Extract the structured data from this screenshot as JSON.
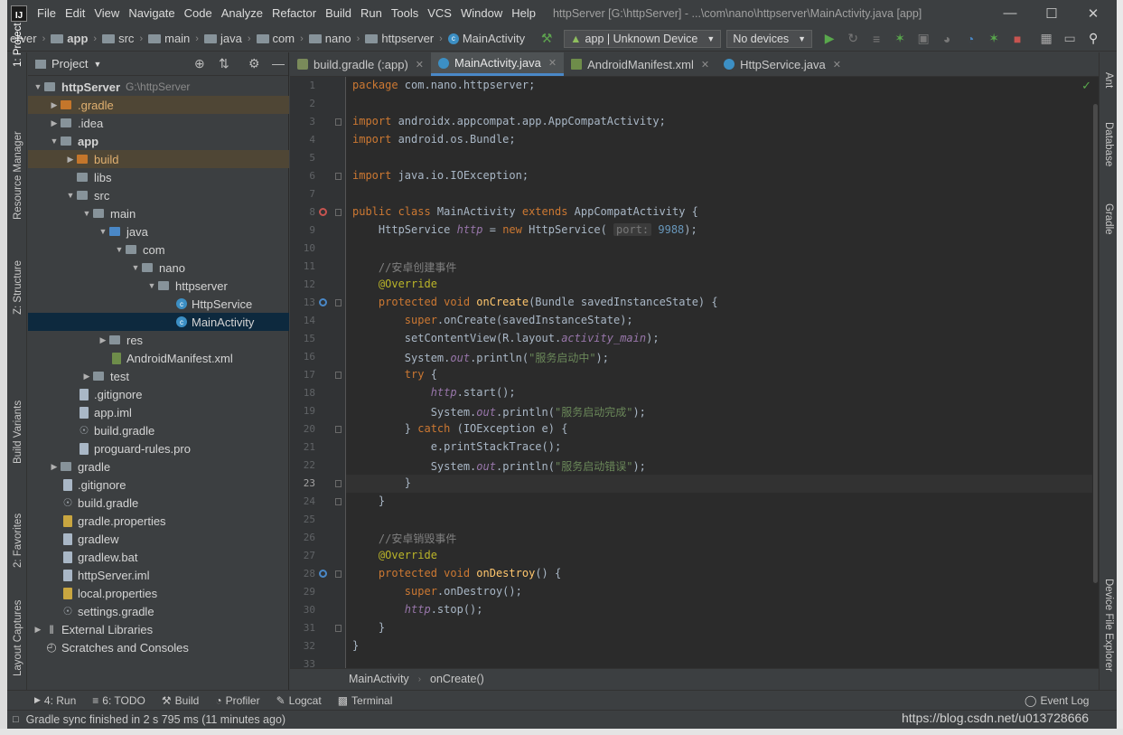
{
  "app": {
    "logo": "IJ",
    "title": "httpServer [G:\\httpServer] - ...\\com\\nano\\httpserver\\MainActivity.java [app]"
  },
  "menu": [
    "File",
    "Edit",
    "View",
    "Navigate",
    "Code",
    "Analyze",
    "Refactor",
    "Build",
    "Run",
    "Tools",
    "VCS",
    "Window",
    "Help"
  ],
  "nav": {
    "crumbs": [
      "erver",
      "app",
      "src",
      "main",
      "java",
      "com",
      "nano",
      "httpserver",
      "MainActivity"
    ],
    "run_config": "app | Unknown Device",
    "device": "No devices"
  },
  "left_tool_tabs": [
    "1: Project",
    "Resource Manager",
    "Z: Structure",
    "Build Variants",
    "2: Favorites",
    "Layout Captures"
  ],
  "right_tool_tabs": [
    "Ant",
    "Database",
    "Gradle",
    "Device File Explorer"
  ],
  "project": {
    "header": "Project",
    "root_path": "G:\\httpServer",
    "tree": [
      {
        "label": "httpServer",
        "depth": 0,
        "arrow": "open",
        "icon": "folder",
        "bold": true
      },
      {
        "label": ".gradle",
        "depth": 1,
        "arrow": "closed",
        "icon": "folder-orange",
        "hl": "orange"
      },
      {
        "label": ".idea",
        "depth": 1,
        "arrow": "closed",
        "icon": "folder"
      },
      {
        "label": "app",
        "depth": 1,
        "arrow": "open",
        "icon": "folder",
        "bold": true
      },
      {
        "label": "build",
        "depth": 2,
        "arrow": "closed",
        "icon": "folder-orange",
        "hl": "orange"
      },
      {
        "label": "libs",
        "depth": 2,
        "arrow": "",
        "icon": "folder"
      },
      {
        "label": "src",
        "depth": 2,
        "arrow": "open",
        "icon": "folder"
      },
      {
        "label": "main",
        "depth": 3,
        "arrow": "open",
        "icon": "folder"
      },
      {
        "label": "java",
        "depth": 4,
        "arrow": "open",
        "icon": "folder-blue"
      },
      {
        "label": "com",
        "depth": 5,
        "arrow": "open",
        "icon": "folder"
      },
      {
        "label": "nano",
        "depth": 6,
        "arrow": "open",
        "icon": "folder"
      },
      {
        "label": "httpserver",
        "depth": 7,
        "arrow": "open",
        "icon": "folder"
      },
      {
        "label": "HttpService",
        "depth": 8,
        "arrow": "",
        "icon": "class"
      },
      {
        "label": "MainActivity",
        "depth": 8,
        "arrow": "",
        "icon": "class",
        "hl": "selected"
      },
      {
        "label": "res",
        "depth": 4,
        "arrow": "closed",
        "icon": "folder"
      },
      {
        "label": "AndroidManifest.xml",
        "depth": 4,
        "arrow": "",
        "icon": "manifest"
      },
      {
        "label": "test",
        "depth": 3,
        "arrow": "closed",
        "icon": "folder"
      },
      {
        "label": ".gitignore",
        "depth": 2,
        "arrow": "",
        "icon": "file"
      },
      {
        "label": "app.iml",
        "depth": 2,
        "arrow": "",
        "icon": "file"
      },
      {
        "label": "build.gradle",
        "depth": 2,
        "arrow": "",
        "icon": "gradle"
      },
      {
        "label": "proguard-rules.pro",
        "depth": 2,
        "arrow": "",
        "icon": "file"
      },
      {
        "label": "gradle",
        "depth": 1,
        "arrow": "closed",
        "icon": "folder"
      },
      {
        "label": ".gitignore",
        "depth": 1,
        "arrow": "",
        "icon": "file"
      },
      {
        "label": "build.gradle",
        "depth": 1,
        "arrow": "",
        "icon": "gradle"
      },
      {
        "label": "gradle.properties",
        "depth": 1,
        "arrow": "",
        "icon": "props"
      },
      {
        "label": "gradlew",
        "depth": 1,
        "arrow": "",
        "icon": "file"
      },
      {
        "label": "gradlew.bat",
        "depth": 1,
        "arrow": "",
        "icon": "file"
      },
      {
        "label": "httpServer.iml",
        "depth": 1,
        "arrow": "",
        "icon": "file"
      },
      {
        "label": "local.properties",
        "depth": 1,
        "arrow": "",
        "icon": "props"
      },
      {
        "label": "settings.gradle",
        "depth": 1,
        "arrow": "",
        "icon": "gradle"
      },
      {
        "label": "External Libraries",
        "depth": 0,
        "arrow": "closed",
        "icon": "lib"
      },
      {
        "label": "Scratches and Consoles",
        "depth": 0,
        "arrow": "",
        "icon": "scratch"
      }
    ]
  },
  "tabs": [
    {
      "label": "build.gradle (:app)",
      "icon": "g"
    },
    {
      "label": "MainActivity.java",
      "icon": "c",
      "active": true
    },
    {
      "label": "AndroidManifest.xml",
      "icon": "m"
    },
    {
      "label": "HttpService.java",
      "icon": "c"
    }
  ],
  "code_lines": [
    [
      [
        "k",
        "package "
      ],
      [
        "",
        "com.nano.httpserver;"
      ]
    ],
    [],
    [
      [
        "k",
        "import "
      ],
      [
        "",
        "androidx.appcompat.app.AppCompatActivity;"
      ]
    ],
    [
      [
        "k",
        "import "
      ],
      [
        "",
        "android.os.Bundle;"
      ]
    ],
    [],
    [
      [
        "k",
        "import "
      ],
      [
        "",
        "java.io.IOException;"
      ]
    ],
    [],
    [
      [
        "k",
        "public class "
      ],
      [
        "",
        "MainActivity "
      ],
      [
        "k",
        "extends "
      ],
      [
        "",
        "AppCompatActivity {"
      ]
    ],
    [
      [
        "",
        "    HttpService "
      ],
      [
        "f",
        "http"
      ],
      [
        "",
        ""
      ],
      [
        "",
        " = "
      ],
      [
        "k",
        "new "
      ],
      [
        "",
        "HttpService( "
      ],
      [
        "h",
        "port:"
      ],
      [
        "n",
        " 9988"
      ],
      [
        "",
        ");"
      ]
    ],
    [],
    [
      [
        "c",
        "    //安卓创建事件"
      ]
    ],
    [
      [
        "a",
        "    @Override"
      ]
    ],
    [
      [
        "k",
        "    protected void "
      ],
      [
        "m",
        "onCreate"
      ],
      [
        "",
        "(Bundle savedInstanceState) {"
      ]
    ],
    [
      [
        "k",
        "        super"
      ],
      [
        "",
        ".onCreate(savedInstanceState);"
      ]
    ],
    [
      [
        "",
        "        setContentView(R.layout."
      ],
      [
        "f",
        "activity_main"
      ],
      [
        "",
        ");"
      ]
    ],
    [
      [
        "",
        "        System."
      ],
      [
        "f",
        "out"
      ],
      [
        "",
        ".println("
      ],
      [
        "s",
        "\"服务启动中\""
      ],
      [
        "",
        ");"
      ]
    ],
    [
      [
        "k",
        "        try "
      ],
      [
        "",
        "{"
      ]
    ],
    [
      [
        "f",
        "            http"
      ],
      [
        "",
        ".start();"
      ]
    ],
    [
      [
        "",
        "            System."
      ],
      [
        "f",
        "out"
      ],
      [
        "",
        ".println("
      ],
      [
        "s",
        "\"服务启动完成\""
      ],
      [
        "",
        ");"
      ]
    ],
    [
      [
        "",
        "        } "
      ],
      [
        "k",
        "catch "
      ],
      [
        "",
        "(IOException e) {"
      ]
    ],
    [
      [
        "",
        "            e.printStackTrace();"
      ]
    ],
    [
      [
        "",
        "            System."
      ],
      [
        "f",
        "out"
      ],
      [
        "",
        ".println("
      ],
      [
        "s",
        "\"服务启动错误\""
      ],
      [
        "",
        ");"
      ]
    ],
    [
      [
        "",
        "        }"
      ]
    ],
    [
      [
        "",
        "    }"
      ]
    ],
    [],
    [
      [
        "c",
        "    //安卓销毁事件"
      ]
    ],
    [
      [
        "a",
        "    @Override"
      ]
    ],
    [
      [
        "k",
        "    protected void "
      ],
      [
        "m",
        "onDestroy"
      ],
      [
        "",
        "() {"
      ]
    ],
    [
      [
        "k",
        "        super"
      ],
      [
        "",
        ".onDestroy();"
      ]
    ],
    [
      [
        "f",
        "        http"
      ],
      [
        "",
        ".stop();"
      ]
    ],
    [
      [
        "",
        "    }"
      ]
    ],
    [
      [
        "",
        "}"
      ]
    ],
    []
  ],
  "editor_crumbs": [
    "MainActivity",
    "onCreate()"
  ],
  "bottom_tabs": [
    "4: Run",
    "6: TODO",
    "Build",
    "Profiler",
    "Logcat",
    "Terminal"
  ],
  "event_log": "Event Log",
  "status": "Gradle sync finished in 2 s 795 ms (11 minutes ago)",
  "watermark": "https://blog.csdn.net/u013728666"
}
